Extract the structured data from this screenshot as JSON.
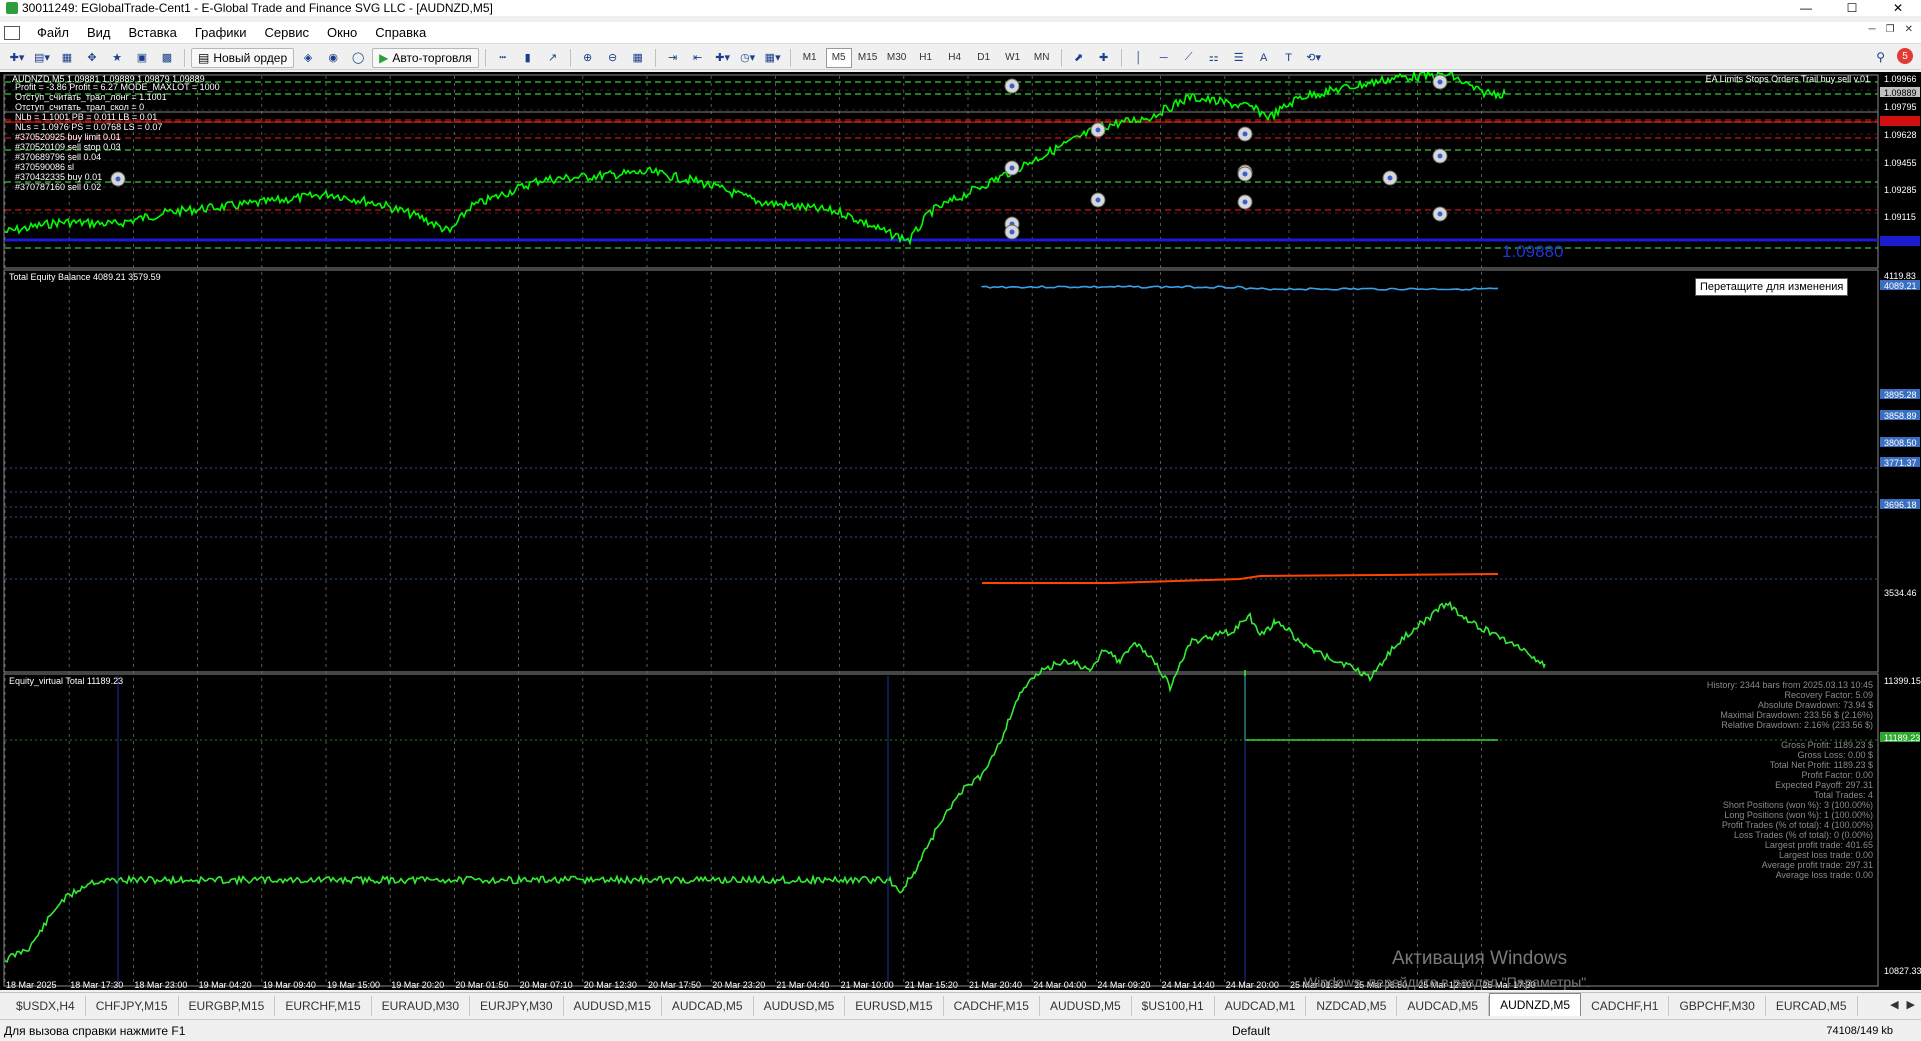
{
  "window": {
    "title": "30011249: EGlobalTrade-Cent1 - E-Global Trade and Finance SVG LLC - [AUDNZD,M5]",
    "minimize": "—",
    "maximize": "☐",
    "close": "✕"
  },
  "menu": {
    "items": [
      "Файл",
      "Вид",
      "Вставка",
      "Графики",
      "Сервис",
      "Окно",
      "Справка"
    ]
  },
  "toolbar": {
    "new_order": "Новый ордер",
    "autotrading": "Авто-торговля",
    "timeframes": [
      "M1",
      "M5",
      "M15",
      "M30",
      "H1",
      "H4",
      "D1",
      "W1",
      "MN"
    ],
    "active_timeframe": "M5",
    "notifications": "5"
  },
  "chart": {
    "main_header": "AUDNZD,M5 1.09881 1.09889 1.09879 1.09889",
    "main_info": [
      "Profit = -3.86 Profit = 6.27 MODE_MAXLOT = 1000",
      "Отступ_считать_трал_лонг = 1.1001",
      "Отступ_считать_трал_скол = 0",
      "NLb = 1.1001 PB = 0.011 LB = 0.01",
      "NLs = 1.0976 PS = 0.0768 LS = 0.07",
      "#370520925 buy limit 0.01",
      "#370520109 sell stop 0.03",
      "#370689796 sell 0.04",
      "#370590086 sl",
      "#370432335 buy 0.01",
      "#370787160 sell 0.02"
    ],
    "ea_name": "EA Limits Stops Orders Trail buy sell v.01",
    "price_labels": [
      "1.09966",
      "1.09889",
      "1.09795",
      "1.09628",
      "1.09455",
      "1.09285",
      "1.09115"
    ],
    "big_price": "1.09880",
    "equity_header": "Total Equity Balance 4089.21 3579.59",
    "equity_labels": [
      "4119.83",
      "4089.21",
      "3895.28",
      "3858.89",
      "3808.50",
      "3771.37",
      "3696.18",
      "3534.46"
    ],
    "virtual_header": "Equity_virtual Total 11189.23",
    "virtual_labels": [
      "11399.15",
      "11189.23",
      "10827.33"
    ],
    "stats": [
      "History: 2344 bars from 2025.03.13 10:45",
      "Recovery Factor: 5.09",
      "Absolute Drawdown: 73.94 $",
      "Maximal Drawdown: 233.56 $ (2.16%)",
      "Relative Drawdown: 2.16% (233.56 $)",
      "",
      "Gross Profit: 1189.23 $",
      "Gross Loss: 0.00 $",
      "Total Net Profit: 1189.23 $",
      "Profit Factor: 0.00",
      "Expected Payoff: 297.31",
      "Total Trades: 4",
      "Short Positions (won %): 3 (100.00%)",
      "Long Positions (won %): 1 (100.00%)",
      "Profit Trades (% of total): 4 (100.00%)",
      "Loss Trades (% of total): 0 (0.00%)",
      "Largest profit trade: 401.65",
      "Largest loss trade: 0.00",
      "Average profit trade: 297.31",
      "Average loss trade: 0.00"
    ],
    "time_labels": [
      "18 Mar 2025",
      "18 Mar 17:30",
      "18 Mar 23:00",
      "19 Mar 04:20",
      "19 Mar 09:40",
      "19 Mar 15:00",
      "19 Mar 20:20",
      "20 Mar 01:50",
      "20 Mar 07:10",
      "20 Mar 12:30",
      "20 Mar 17:50",
      "20 Mar 23:20",
      "21 Mar 04:40",
      "21 Mar 10:00",
      "21 Mar 15:20",
      "21 Mar 20:40",
      "24 Mar 04:00",
      "24 Mar 09:20",
      "24 Mar 14:40",
      "24 Mar 20:00",
      "25 Mar 01:30",
      "25 Mar 06:50",
      "25 Mar 12:10",
      "25 Mar 17:30"
    ],
    "tooltip": "Перетащите для изменения"
  },
  "watermark": {
    "line1": "Активация Windows",
    "line2": "Windows, перейдите в раздел \"Параметры\"."
  },
  "tabs": [
    "$USDX,H4",
    "CHFJPY,M15",
    "EURGBP,M15",
    "EURCHF,M15",
    "EURAUD,M30",
    "EURJPY,M30",
    "AUDUSD,M15",
    "AUDCAD,M5",
    "AUDUSD,M5",
    "EURUSD,M15",
    "CADCHF,M15",
    "AUDUSD,M5",
    "$US100,H1",
    "AUDCAD,M1",
    "NZDCAD,M5",
    "AUDCAD,M5",
    "AUDNZD,M5",
    "CADCHF,H1",
    "GBPCHF,M30",
    "EURCAD,M5"
  ],
  "active_tab": "AUDNZD,M5",
  "status": {
    "help": "Для вызова справки нажмите F1",
    "profile": "Default",
    "traffic": "74108/149 kb"
  },
  "colors": {
    "price_line": "#00ff00",
    "equity_line": "#3aa0e8",
    "balance_line": "#ff4500",
    "virtual_line": "#33ee33",
    "sl_line": "#d01010",
    "bid_line": "#1b1bd0"
  }
}
